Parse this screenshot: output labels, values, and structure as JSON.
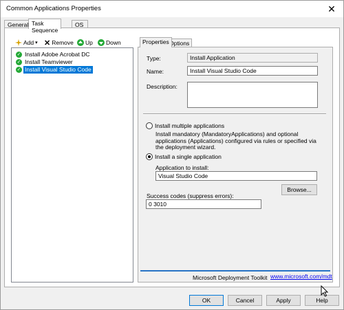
{
  "window": {
    "title": "Common Applications Properties"
  },
  "outer_tabs": [
    {
      "label": "General"
    },
    {
      "label": "Task Sequence"
    },
    {
      "label": "OS Info"
    }
  ],
  "toolbar": {
    "add": "Add",
    "remove": "Remove",
    "up": "Up",
    "down": "Down"
  },
  "tree": [
    {
      "label": "Install Adobe Acrobat DC",
      "selected": false
    },
    {
      "label": "Install Teamviewer",
      "selected": false
    },
    {
      "label": "Install Visual Studio Code",
      "selected": true
    }
  ],
  "inner_tabs": [
    {
      "label": "Properties"
    },
    {
      "label": "Options"
    }
  ],
  "properties": {
    "type_label": "Type:",
    "type_value": "Install Application",
    "name_label": "Name:",
    "name_value": "Install Visual Studio Code",
    "description_label": "Description:",
    "description_value": "",
    "radio_multiple": "Install multiple applications",
    "radio_multiple_desc": "Install mandatory (MandatoryApplications) and optional applications (Applications) configured via rules or specified via the deployment wizard.",
    "radio_single": "Install a single application",
    "app_to_install_label": "Application to install:",
    "app_to_install_value": "Visual Studio Code",
    "browse": "Browse...",
    "success_codes_label": "Success codes (suppress errors):",
    "success_codes_value": "0 3010",
    "footer_text": "Microsoft Deployment Toolkit",
    "footer_link": "www.microsoft.com/mdt"
  },
  "buttons": {
    "ok": "OK",
    "cancel": "Cancel",
    "apply": "Apply",
    "help": "Help"
  },
  "colors": {
    "accent": "#0078d7",
    "check": "#23a936",
    "link": "#0000ee"
  }
}
